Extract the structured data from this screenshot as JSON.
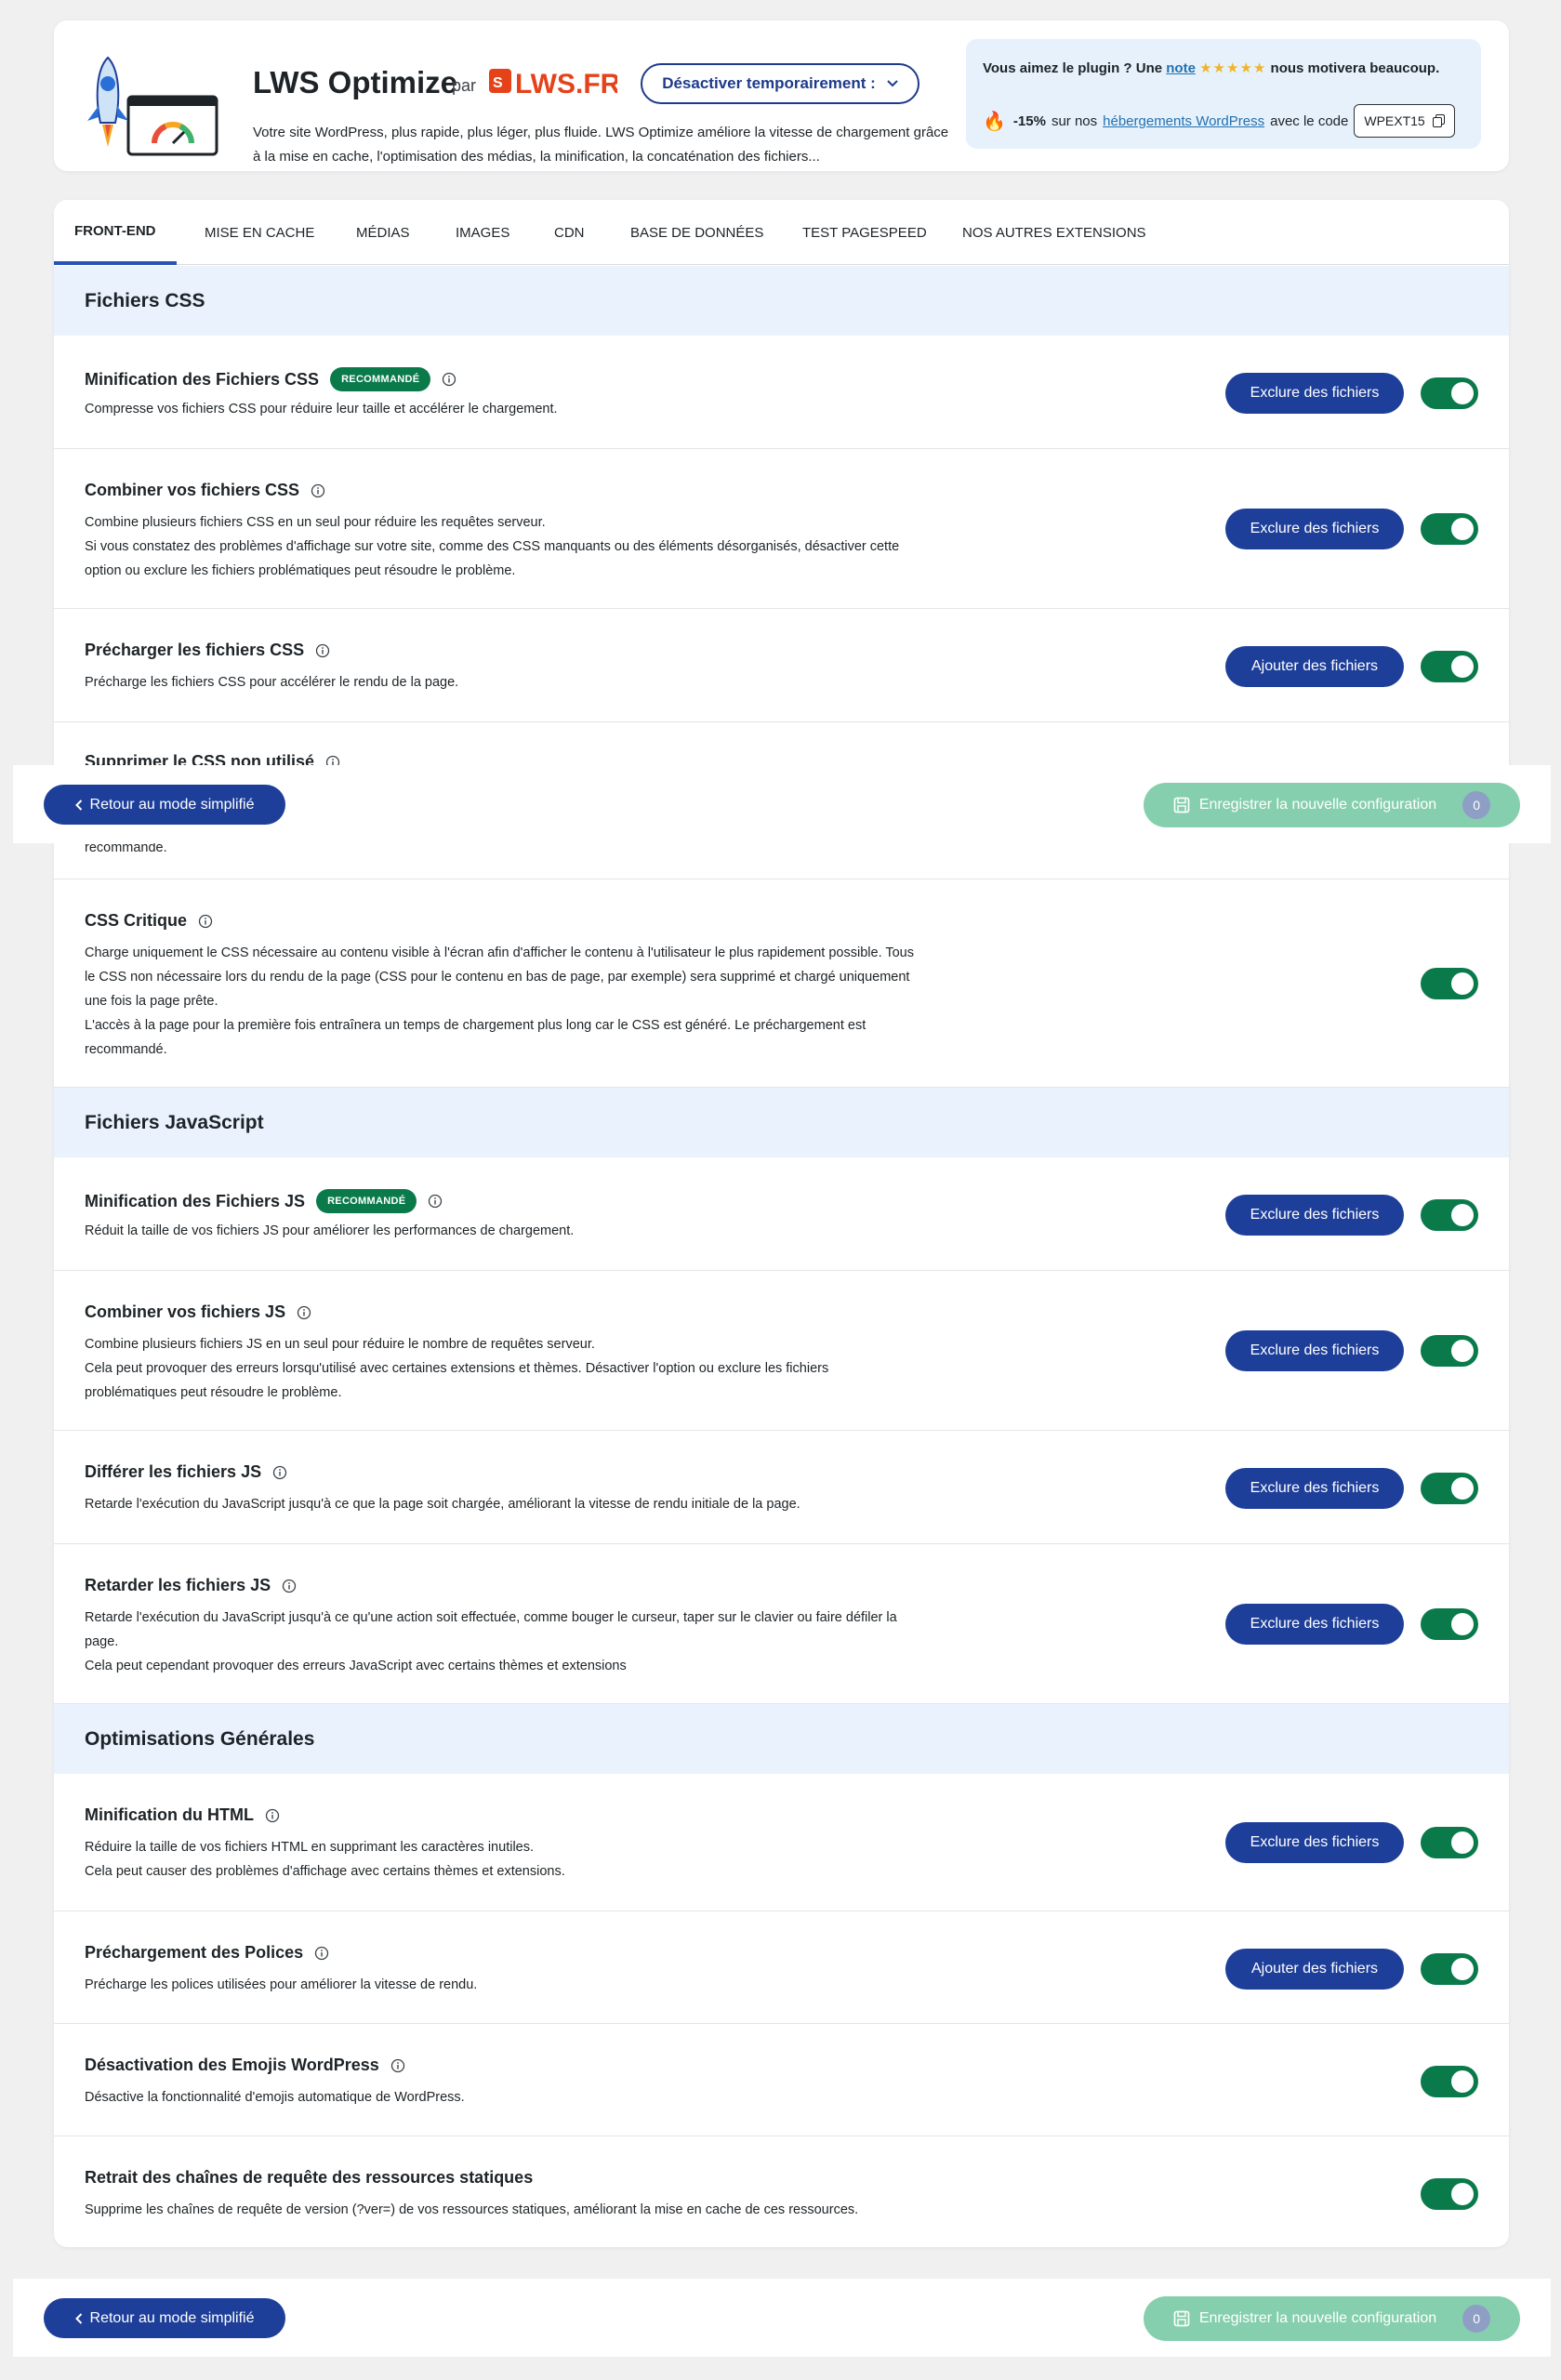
{
  "header": {
    "title": "LWS Optimize",
    "by_label": "par",
    "brand_logo_text": "LWS.FR",
    "deactivate_label": "Désactiver temporairement :",
    "description_line1": "Votre site WordPress, plus rapide, plus léger, plus fluide. LWS Optimize améliore la vitesse de chargement grâce",
    "description_line2": "à la mise en cache, l'optimisation des médias, la minification, la concaténation des fichiers...",
    "promo": {
      "line1_prefix": "Vous aimez le plugin ? Une",
      "line1_link": "note",
      "stars": "★★★★★",
      "line1_suffix": "nous motivera beaucoup.",
      "discount": "-15%",
      "line2_prefix": "sur nos",
      "line2_link": "hébergements WordPress",
      "line2_suffix": "avec le code",
      "code": "WPEXT15"
    }
  },
  "tabs": [
    {
      "label": "FRONT-END",
      "active": true
    },
    {
      "label": "MISE EN CACHE"
    },
    {
      "label": "MÉDIAS"
    },
    {
      "label": "IMAGES"
    },
    {
      "label": "CDN"
    },
    {
      "label": "BASE DE DONNÉES"
    },
    {
      "label": "TEST PAGESPEED"
    },
    {
      "label": "NOS AUTRES EXTENSIONS"
    }
  ],
  "sections": {
    "css": "Fichiers CSS",
    "js": "Fichiers JavaScript",
    "general": "Optimisations Générales"
  },
  "badge_label": "RECOMMANDÉ",
  "rows": {
    "css_min": {
      "title": "Minification des Fichiers CSS",
      "desc": [
        "Compresse vos fichiers CSS pour réduire leur taille et accélérer le chargement."
      ],
      "button": "Exclure des fichiers"
    },
    "css_combine": {
      "title": "Combiner vos fichiers CSS",
      "desc": [
        "Combine plusieurs fichiers CSS en un seul pour réduire les requêtes serveur.",
        "Si vous constatez des problèmes d'affichage sur votre site, comme des CSS manquants ou des éléments désorganisés, désactiver cette",
        "option ou exclure les fichiers problématiques peut résoudre le problème."
      ],
      "button": "Exclure des fichiers"
    },
    "css_preload": {
      "title": "Précharger les fichiers CSS",
      "desc": [
        "Précharge les fichiers CSS pour accélérer le rendu de la page."
      ],
      "button": "Ajouter des fichiers"
    },
    "css_unused": {
      "title": "Supprimer le CSS non utilisé",
      "desc_tail": "recommandé."
    },
    "css_critical": {
      "title": "CSS Critique",
      "desc": [
        "Charge uniquement le CSS nécessaire au contenu visible à l'écran afin d'afficher le contenu à l'utilisateur le plus rapidement possible. Tous",
        "le CSS non nécessaire lors du rendu de la page (CSS pour le contenu en bas de page, par exemple) sera supprimé et chargé uniquement",
        "une fois la page prête.",
        "L'accès à la page pour la première fois entraînera un temps de chargement plus long car le CSS est généré. Le préchargement est",
        "recommandé."
      ]
    },
    "js_min": {
      "title": "Minification des Fichiers JS",
      "desc": [
        "Réduit la taille de vos fichiers JS pour améliorer les performances de chargement."
      ],
      "button": "Exclure des fichiers"
    },
    "js_combine": {
      "title": "Combiner vos fichiers JS",
      "desc": [
        "Combine plusieurs fichiers JS en un seul pour réduire le nombre de requêtes serveur.",
        "Cela peut provoquer des erreurs lorsqu'utilisé avec certaines extensions et thèmes. Désactiver l'option ou exclure les fichiers",
        "problématiques peut résoudre le problème."
      ],
      "button": "Exclure des fichiers"
    },
    "js_defer": {
      "title": "Différer les fichiers JS",
      "desc": [
        "Retarde l'exécution du JavaScript jusqu'à ce que la page soit chargée, améliorant la vitesse de rendu initiale de la page."
      ],
      "button": "Exclure des fichiers"
    },
    "js_delay": {
      "title": "Retarder les fichiers JS",
      "desc": [
        "Retarde l'exécution du JavaScript jusqu'à ce qu'une action soit effectuée, comme bouger le curseur, taper sur le clavier ou faire défiler la",
        "page.",
        "Cela peut cependant provoquer des erreurs JavaScript avec certains thèmes et extensions"
      ],
      "button": "Exclure des fichiers"
    },
    "html_min": {
      "title": "Minification du HTML",
      "desc": [
        "Réduire la taille de vos fichiers HTML en supprimant les caractères inutiles.",
        "Cela peut causer des problèmes d'affichage avec certains thèmes et extensions."
      ],
      "button": "Exclure des fichiers"
    },
    "fonts_preload": {
      "title": "Préchargement des Polices",
      "desc": [
        "Précharge les polices utilisées pour améliorer la vitesse de rendu."
      ],
      "button": "Ajouter des fichiers"
    },
    "emojis": {
      "title": "Désactivation des Emojis WordPress",
      "desc": [
        "Désactive la fonctionnalité d'emojis automatique de WordPress."
      ]
    },
    "query_strings": {
      "title": "Retrait des chaînes de requête des ressources statiques",
      "desc": [
        "Supprime les chaînes de requête de version (?ver=) de vos ressources statiques, améliorant la mise en cache de ces ressources."
      ]
    }
  },
  "footer": {
    "back_label": "Retour au mode simplifié",
    "save_label": "Enregistrer la nouvelle configuration",
    "save_count": "0"
  },
  "colors": {
    "primary": "#1e3f99",
    "toggle_on": "#0a7a4b",
    "section_bg": "#eaf3fd",
    "save_disabled": "#86cfae"
  }
}
